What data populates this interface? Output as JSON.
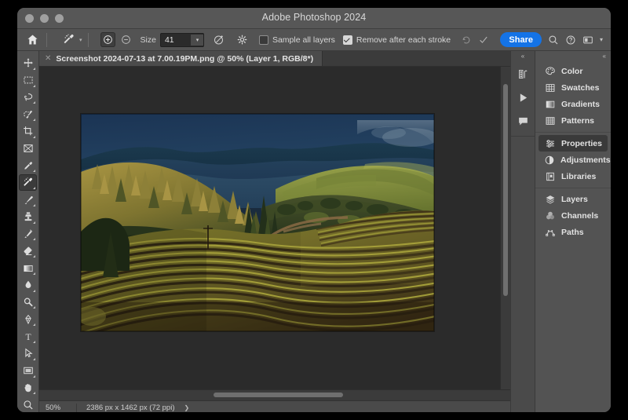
{
  "window": {
    "title": "Adobe Photoshop 2024",
    "traffic_lights": [
      "close",
      "minimize",
      "zoom"
    ]
  },
  "options_bar": {
    "home_icon": "home-icon",
    "active_tool_icon": "spot-healing-brush-icon",
    "add_mode_icon": "add-to-selection-icon",
    "subtract_mode_icon": "subtract-from-selection-icon",
    "size_label": "Size",
    "size_value": "41",
    "size_dropdown_icon": "chevron-down-icon",
    "brush_preset_icon": "brush-preset-icon",
    "settings_icon": "gear-icon",
    "sample_all_layers": {
      "label": "Sample all layers",
      "checked": false
    },
    "remove_after_each_stroke": {
      "label": "Remove after each stroke",
      "checked": true
    },
    "reset_icon": "undo-reset-icon",
    "confirm_icon": "checkmark-icon",
    "share_label": "Share",
    "search_icon": "search-icon",
    "help_icon": "help-circle-icon",
    "workspace_icon": "workspace-switcher-icon",
    "workspace_caret_icon": "chevron-down-icon"
  },
  "toolbar": {
    "tools": [
      {
        "name": "move-tool",
        "icon": "move-arrows-icon",
        "selected": false,
        "has_flyout": true
      },
      {
        "name": "rectangular-marquee-tool",
        "icon": "marquee-dashed-rect-icon",
        "selected": false,
        "has_flyout": true
      },
      {
        "name": "lasso-tool",
        "icon": "lasso-icon",
        "selected": false,
        "has_flyout": true
      },
      {
        "name": "object-selection-tool",
        "icon": "quick-selection-icon",
        "selected": false,
        "has_flyout": true
      },
      {
        "name": "crop-tool",
        "icon": "crop-icon",
        "selected": false,
        "has_flyout": true
      },
      {
        "name": "frame-tool",
        "icon": "frame-icon",
        "selected": false,
        "has_flyout": false
      },
      {
        "name": "eyedropper-tool",
        "icon": "eyedropper-icon",
        "selected": false,
        "has_flyout": true
      },
      {
        "name": "spot-healing-brush-tool",
        "icon": "spot-healing-brush-icon",
        "selected": true,
        "has_flyout": true
      },
      {
        "name": "brush-tool",
        "icon": "brush-icon",
        "selected": false,
        "has_flyout": true
      },
      {
        "name": "clone-stamp-tool",
        "icon": "clone-stamp-icon",
        "selected": false,
        "has_flyout": true
      },
      {
        "name": "history-brush-tool",
        "icon": "history-brush-icon",
        "selected": false,
        "has_flyout": true
      },
      {
        "name": "eraser-tool",
        "icon": "eraser-icon",
        "selected": false,
        "has_flyout": true
      },
      {
        "name": "gradient-tool",
        "icon": "gradient-icon",
        "selected": false,
        "has_flyout": true
      },
      {
        "name": "blur-tool",
        "icon": "blur-droplet-icon",
        "selected": false,
        "has_flyout": true
      },
      {
        "name": "dodge-tool",
        "icon": "dodge-icon",
        "selected": false,
        "has_flyout": true
      },
      {
        "name": "pen-tool",
        "icon": "pen-icon",
        "selected": false,
        "has_flyout": true
      },
      {
        "name": "type-tool",
        "icon": "type-t-icon",
        "selected": false,
        "has_flyout": true
      },
      {
        "name": "path-selection-tool",
        "icon": "path-arrow-icon",
        "selected": false,
        "has_flyout": true
      },
      {
        "name": "rectangle-tool",
        "icon": "rectangle-shape-icon",
        "selected": false,
        "has_flyout": true
      },
      {
        "name": "hand-tool",
        "icon": "hand-icon",
        "selected": false,
        "has_flyout": true
      },
      {
        "name": "zoom-tool",
        "icon": "magnifier-icon",
        "selected": false,
        "has_flyout": false
      }
    ]
  },
  "document": {
    "tab_title": "Screenshot 2024-07-13 at 7.00.19PM.png @ 50% (Layer 1, RGB/8*)",
    "tab_close_icon": "close-x-icon"
  },
  "status_bar": {
    "zoom": "50%",
    "dimensions": "2386 px x 1462 px (72 ppi)",
    "expand_icon": "chevron-right-icon"
  },
  "dock": {
    "collapse_rail_icon": "double-chevron-left-icon",
    "collapse_panel_icon": "double-chevron-left-icon",
    "rail_icons": [
      {
        "name": "histogram-panel-icon",
        "icon": "histogram-icon"
      },
      {
        "name": "actions-panel-icon",
        "icon": "play-triangle-icon"
      },
      {
        "name": "comments-panel-icon",
        "icon": "speech-bubble-icon"
      }
    ],
    "groups": [
      {
        "items": [
          {
            "label": "Color",
            "icon": "color-palette-icon",
            "active": false
          },
          {
            "label": "Swatches",
            "icon": "swatches-grid-icon",
            "active": false
          },
          {
            "label": "Gradients",
            "icon": "gradient-square-icon",
            "active": false
          },
          {
            "label": "Patterns",
            "icon": "patterns-grid-icon",
            "active": false
          }
        ]
      },
      {
        "items": [
          {
            "label": "Properties",
            "icon": "sliders-icon",
            "active": true
          },
          {
            "label": "Adjustments",
            "icon": "half-circle-icon",
            "active": false
          },
          {
            "label": "Libraries",
            "icon": "libraries-book-icon",
            "active": false
          }
        ]
      },
      {
        "items": [
          {
            "label": "Layers",
            "icon": "layers-stack-icon",
            "active": false
          },
          {
            "label": "Channels",
            "icon": "channels-venn-icon",
            "active": false
          },
          {
            "label": "Paths",
            "icon": "paths-bezier-icon",
            "active": false
          }
        ]
      }
    ]
  },
  "canvas": {
    "image_description": "Golden-hour landscape photograph: hazy blue-gray mountain ridges in the distance, sunlit conifer forest on the left, rolling green hills with a dirt road, and curved rows of a vineyard filling the foreground.",
    "vertical_scrollbar": "vertical-scrollbar",
    "horizontal_scrollbar": "horizontal-scrollbar"
  },
  "colors": {
    "accent_blue": "#1473e6",
    "window_chrome": "#535353",
    "canvas_background": "#2b2b2b",
    "panel_active": "#3a3a3a",
    "sky_blue": "#1d3450",
    "forest_gold": "#9a8a3c",
    "vineyard_olive": "#8f8a2e",
    "vineyard_soil": "#3a2a18",
    "hill_green": "#6e7c33"
  }
}
